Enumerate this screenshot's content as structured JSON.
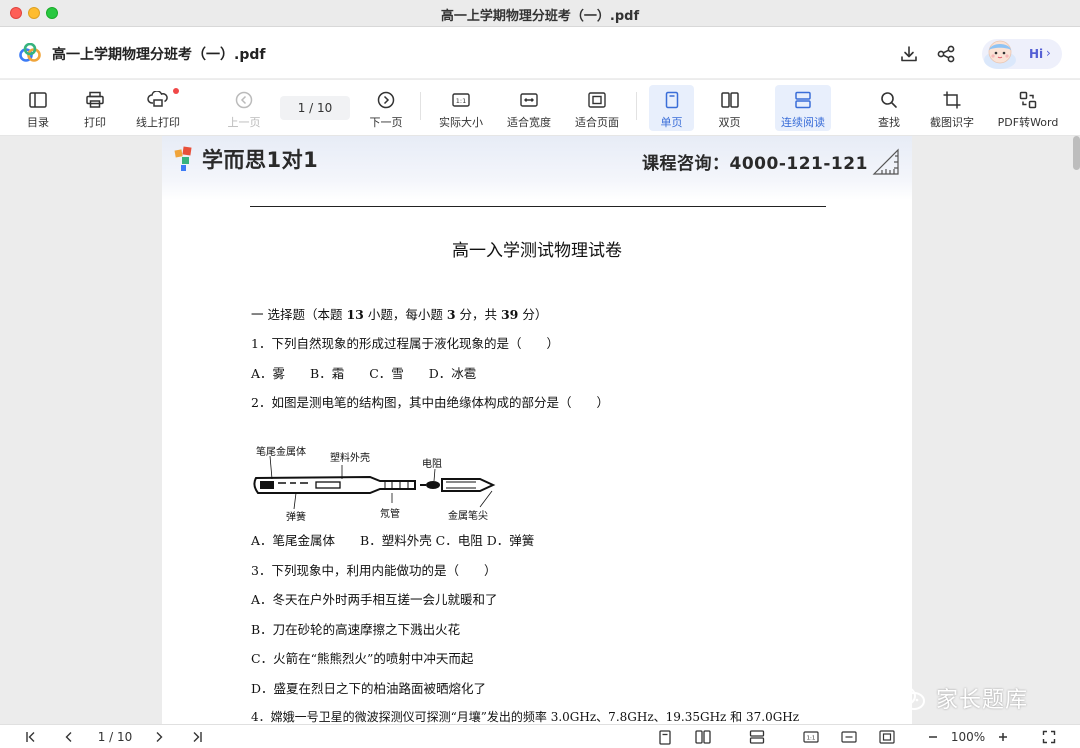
{
  "window": {
    "title": "高一上学期物理分班考（一）.pdf"
  },
  "header": {
    "doc_title": "高一上学期物理分班考（一）.pdf",
    "hi_label": "Hi"
  },
  "toolbar": {
    "toc": "目录",
    "print": "打印",
    "online_print": "线上打印",
    "prev_page": "上一页",
    "page_indicator": "1  /  10",
    "next_page": "下一页",
    "actual_size": "实际大小",
    "fit_width": "适合宽度",
    "fit_page": "适合页面",
    "single_page": "单页",
    "double_page": "双页",
    "continuous": "连续阅读",
    "find": "查找",
    "ocr": "截图识字",
    "pdf_to_word": "PDF转Word"
  },
  "document": {
    "brand": "学而思1对1",
    "consult": "课程咨询：4000-121-121",
    "exam_title": "高一入学测试物理试卷",
    "section_pre": "一  选择题（本题 ",
    "section_n1": "13",
    "section_mid1": " 小题，每小题 ",
    "section_n2": "3",
    "section_mid2": " 分，共 ",
    "section_n3": "39",
    "section_post": " 分）",
    "q1": "1．下列自然现象的形成过程属于液化现象的是（　　）",
    "q1_opts": "A．雾　　B．霜　　C．雪　　D．冰雹",
    "q2": "2．如图是测电笔的结构图，其中由绝缘体构成的部分是（　　）",
    "pen_labels": {
      "tail": "笔尾金属体",
      "shell": "塑料外壳",
      "resistor": "电阻",
      "spring": "弹簧",
      "tube": "氖管",
      "tip": "金属笔尖"
    },
    "q2_opts": "A．笔尾金属体　　B．塑料外壳 C．电阻 D．弹簧",
    "q3": "3．下列现象中，利用内能做功的是（　　）",
    "q3_a": "A．冬天在户外时两手相互搓一会儿就暖和了",
    "q3_b": "B．刀在砂轮的高速摩擦之下溅出火花",
    "q3_c": "C．火箭在“熊熊烈火”的喷射中冲天而起",
    "q3_d": "D．盛夏在烈日之下的柏油路面被晒熔化了",
    "q4": "4．嫦娥一号卫星的微波探测仪可探测“月壤”发出的频率 3.0GHz、7.8GHz、19.35GHz 和 37.0GHz"
  },
  "watermark": {
    "text": "家长题库"
  },
  "bottombar": {
    "page_indicator": "1  /  10",
    "zoom": "100%"
  },
  "colors": {
    "accent": "#3a6ed8",
    "active_bg": "#e8effc",
    "notification": "#f04848"
  }
}
